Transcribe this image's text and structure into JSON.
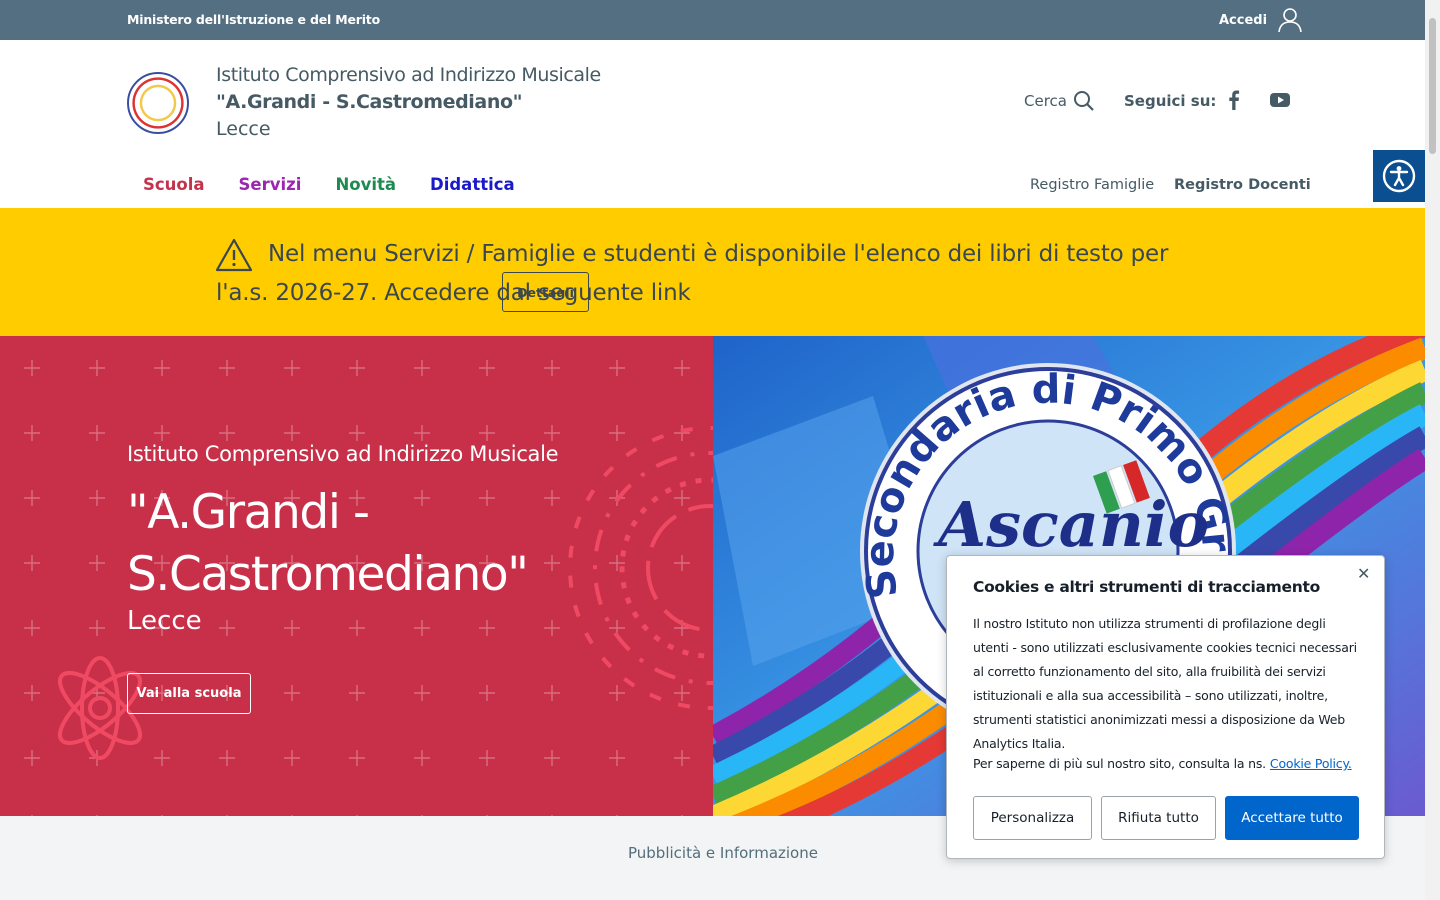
{
  "topbar": {
    "ministry": "Ministero dell'Istruzione e del Merito",
    "login": "Accedi"
  },
  "header": {
    "line1": "Istituto Comprensivo ad Indirizzo Musicale",
    "line2": "\"A.Grandi - S.Castromediano\"",
    "line3": "Lecce",
    "search": "Cerca",
    "follow": "Seguici su:",
    "social": [
      "facebook-icon",
      "youtube-icon"
    ]
  },
  "nav": {
    "items": [
      {
        "label": "Scuola",
        "color": "#c3334c"
      },
      {
        "label": "Servizi",
        "color": "#9b27b0"
      },
      {
        "label": "Novità",
        "color": "#1d8a4f"
      },
      {
        "label": "Didattica",
        "color": "#1a1ac8"
      }
    ],
    "reg_famiglie": "Registro Famiglie",
    "reg_docenti": "Registro Docenti"
  },
  "notice": {
    "text": "Nel menu Servizi / Famiglie e studenti è disponibile l'elenco dei libri di testo per l'a.s. 2026-27. Accedere dal seguente link",
    "button": "Dettagli"
  },
  "hero": {
    "subtitle": "Istituto Comprensivo ad Indirizzo Musicale",
    "title": "\"A.Grandi - S.Castromediano\"",
    "city": "Lecce",
    "button": "Vai alla scuola",
    "image_text_1": "Secondaria di Primo Grado ad indirizzo mu",
    "image_text_2": "Ascanio"
  },
  "below": {
    "title": "Pubblicità e Informazione"
  },
  "cookie": {
    "title": "Cookies e altri strumenti di tracciamento",
    "body": "Il nostro Istituto non utilizza strumenti di profilazione degli utenti - sono utilizzati esclusivamente cookies tecnici necessari al corretto funzionamento del sito, alla fruibilità dei servizi istituzionali e alla sua accessibilità – sono utilizzati, inoltre, strumenti statistici anonimizzati messi a disposizione da Web Analytics Italia.",
    "policy_text": "Per saperne di più sul nostro sito, consulta la ns.",
    "policy_link": "Cookie Policy.",
    "btn_customize": "Personalizza",
    "btn_reject": "Rifiuta tutto",
    "btn_accept": "Accettare tutto"
  }
}
